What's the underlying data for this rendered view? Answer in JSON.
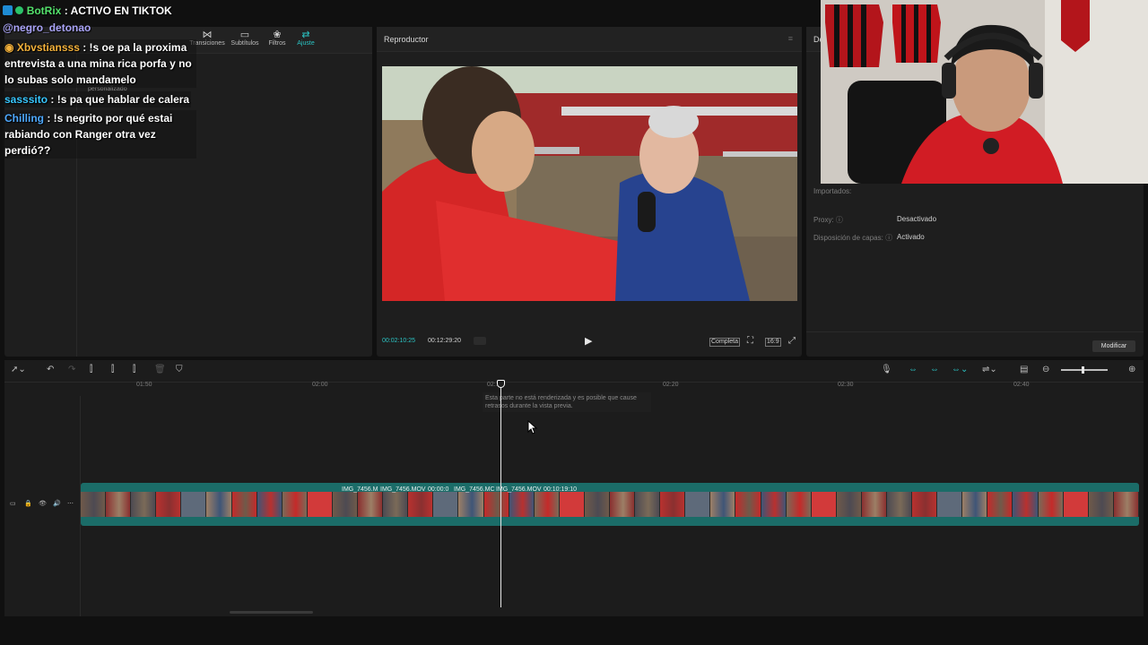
{
  "overlay": {
    "title_user": "BotRix",
    "title_sep": ":",
    "title_msg": "ACTIVO EN TIKTOK",
    "mention": "@negro_detonao",
    "chat": [
      {
        "user": "Xbvstiansss",
        "user_color": "#f2b03a",
        "text": ": !s oe pa la proxima entrevista a una mina rica porfa y no lo subas solo mandamelo"
      },
      {
        "user": "sasssito",
        "user_color": "#38c7ff",
        "text": ": !s pa que hablar de calera"
      },
      {
        "user": "Chilling",
        "user_color": "#4ea9ff",
        "text": ": !s negrito por qué estai rabiando con Ranger otra vez perdió??"
      }
    ]
  },
  "media_panel": {
    "tabs": [
      {
        "label": "Transiciones",
        "icon": "transitions-icon"
      },
      {
        "label": "Subtítulos",
        "icon": "subtitles-icon"
      },
      {
        "label": "Filtros",
        "icon": "filters-icon"
      },
      {
        "label": "Ajuste",
        "icon": "adjust-icon",
        "active": true
      }
    ],
    "subitem": "personalizado"
  },
  "player": {
    "title": "Reproductor",
    "current_time": "00:02:10:25",
    "total_time": "00:12:29:20",
    "quality_label": "Completa",
    "ratio_label": "16:9"
  },
  "details": {
    "header": "De",
    "imported_label": "Importados:",
    "rows": [
      {
        "label": "Proxy:",
        "value": "Desactivado"
      },
      {
        "label": "Disposición de capas:",
        "value": "Activado"
      }
    ],
    "modify_button": "Modificar"
  },
  "timeline": {
    "ruler": [
      "01:50",
      "02:00",
      "02:10",
      "02:20",
      "02:30",
      "02:40"
    ],
    "tooltip": "Esta parte no está renderizada y es posible que cause retrasos durante la vista previa.",
    "clip_labels": [
      "IMG_7456.M",
      "IMG_7456.MOV",
      "00:00:0",
      "IMG_7456.MC",
      "IMG_7456.MOV",
      "00:10:19:10"
    ]
  },
  "colors": {
    "accent": "#2bc3c3",
    "panel": "#1e1e1e",
    "track": "#1b6c68"
  }
}
